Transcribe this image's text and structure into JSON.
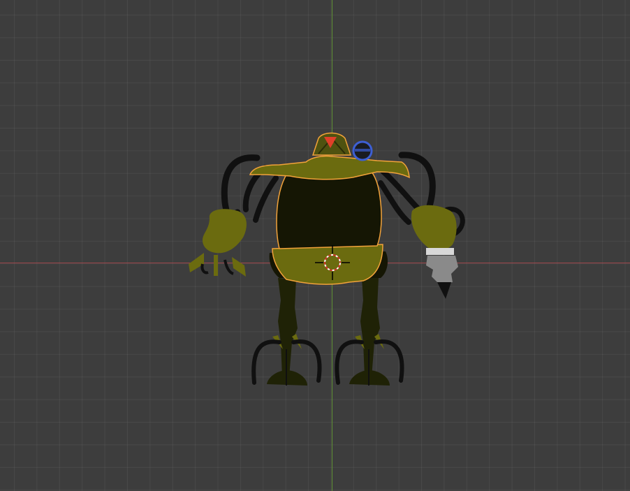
{
  "viewport": {
    "mode": "3d-viewport",
    "view": "front-orthographic",
    "background_color": "#3d3d3d",
    "grid_color": "#4a4a4a",
    "x_axis_color": "#b3565a",
    "y_axis_color": "#6a9a3a"
  },
  "scene": {
    "object": "robot-character",
    "selection_outline_color": "#f2a23a",
    "colors": {
      "olive": "#6b6b0f",
      "dark_olive": "#1f2206",
      "darkest": "#151604",
      "black": "#101010",
      "gray": "#8a8a8a",
      "red": "#e0402a",
      "blue_ring": "#3d5fd4"
    },
    "cursor": "3d-cursor"
  }
}
